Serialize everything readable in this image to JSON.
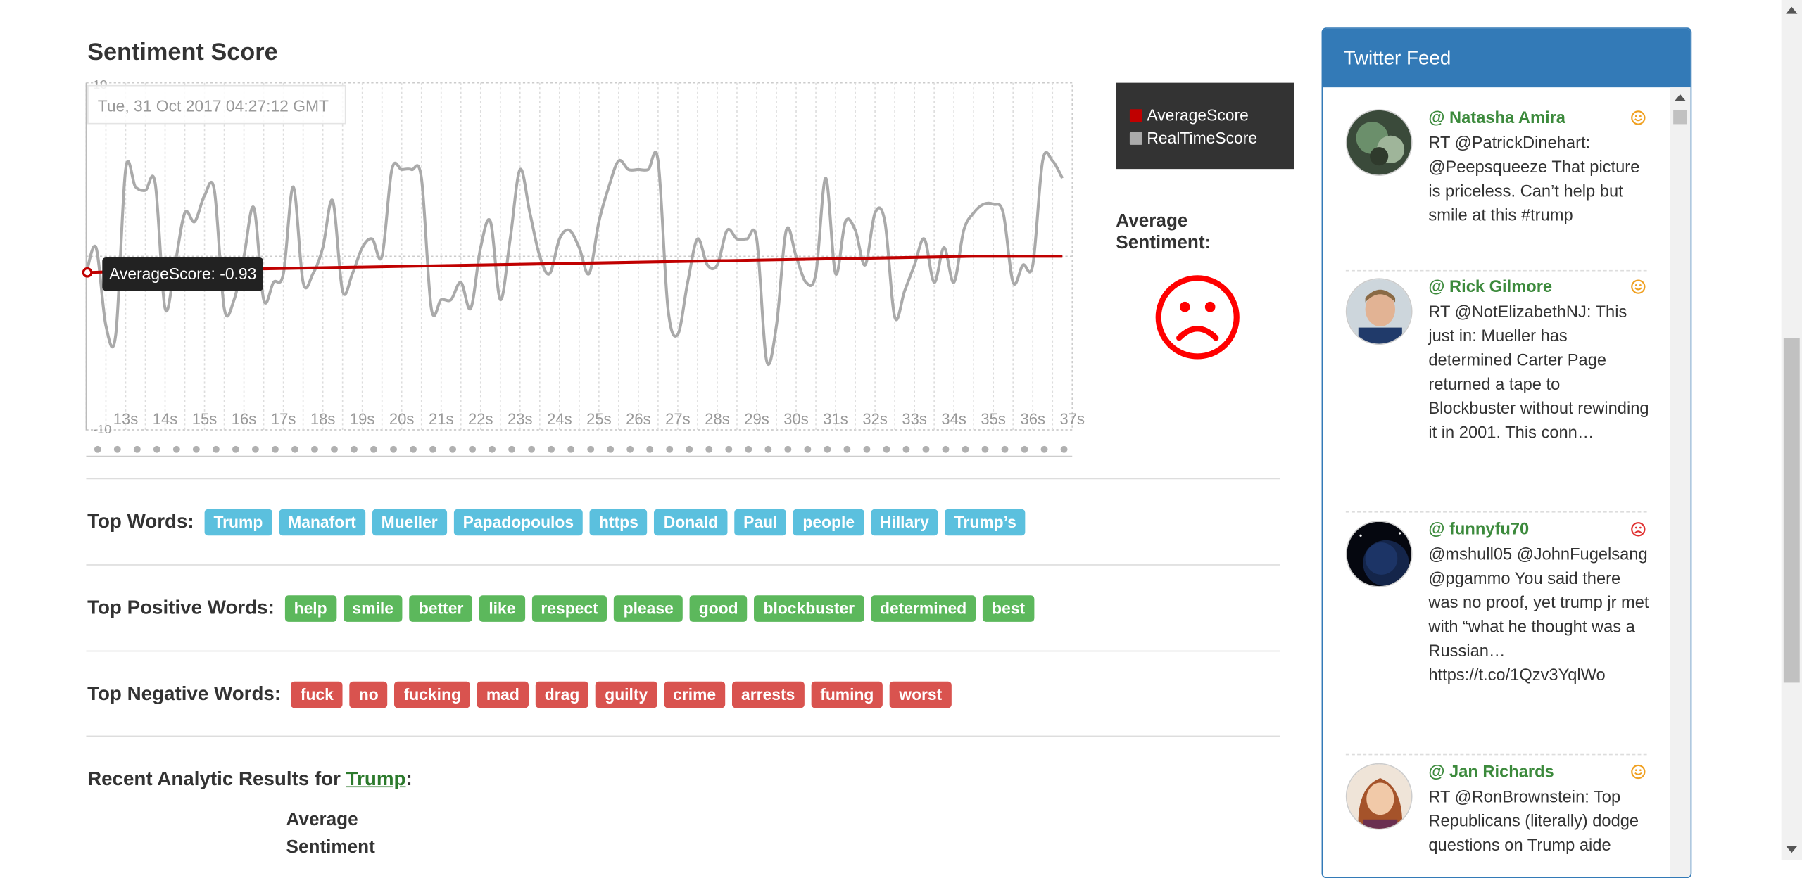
{
  "page": {
    "title": "Sentiment Score",
    "top_words_label": "Top Words:",
    "top_positive_label": "Top Positive Words:",
    "top_negative_label": "Top Negative Words:",
    "recent_prefix": "Recent Analytic Results for ",
    "recent_term": "Trump",
    "recent_suffix": ":",
    "avg_sentiment_line1": "Average",
    "avg_sentiment_line2": "Sentiment"
  },
  "top_words": [
    "Trump",
    "Manafort",
    "Mueller",
    "Papadopoulos",
    "https",
    "Donald",
    "Paul",
    "people",
    "Hillary",
    "Trump’s"
  ],
  "top_positive_words": [
    "help",
    "smile",
    "better",
    "like",
    "respect",
    "please",
    "good",
    "blockbuster",
    "determined",
    "best"
  ],
  "top_negative_words": [
    "fuck",
    "no",
    "fucking",
    "mad",
    "drag",
    "guilty",
    "crime",
    "arrests",
    "fuming",
    "worst"
  ],
  "sentiment_panel": {
    "label": "Average Sentiment:",
    "face": "sad-face-icon",
    "face_color": "#ff0000"
  },
  "chart_data": {
    "type": "line",
    "hover_date": "Tue, 31 Oct 2017 04:27:12 GMT",
    "hover_tooltip": "AverageScore: -0.93",
    "ylim": [
      -10,
      10
    ],
    "y_ticks": [
      "10",
      "-10"
    ],
    "x_tick_labels": [
      "13s",
      "14s",
      "15s",
      "16s",
      "17s",
      "18s",
      "19s",
      "20s",
      "21s",
      "22s",
      "23s",
      "24s",
      "25s",
      "26s",
      "27s",
      "28s",
      "29s",
      "30s",
      "31s",
      "32s",
      "33s",
      "34s",
      "35s",
      "36s",
      "37s"
    ],
    "grid": true,
    "legend_position": "right",
    "x": [
      12.0,
      12.25,
      12.5,
      12.75,
      13.0,
      13.25,
      13.5,
      13.75,
      14.0,
      14.25,
      14.5,
      14.75,
      15.0,
      15.25,
      15.5,
      15.75,
      16.0,
      16.25,
      16.5,
      16.75,
      17.0,
      17.25,
      17.5,
      17.75,
      18.0,
      18.25,
      18.5,
      18.75,
      19.0,
      19.25,
      19.5,
      19.75,
      20.0,
      20.25,
      20.5,
      20.75,
      21.0,
      21.25,
      21.5,
      21.75,
      22.0,
      22.25,
      22.5,
      22.75,
      23.0,
      23.25,
      23.5,
      23.75,
      24.0,
      24.25,
      24.5,
      24.75,
      25.0,
      25.25,
      25.5,
      25.75,
      26.0,
      26.25,
      26.5,
      26.75,
      27.0,
      27.25,
      27.5,
      27.75,
      28.0,
      28.25,
      28.5,
      28.75,
      29.0,
      29.25,
      29.5,
      29.75,
      30.0,
      30.25,
      30.5,
      30.75,
      31.0,
      31.25,
      31.5,
      31.75,
      32.0,
      32.25,
      32.5,
      32.75,
      33.0,
      33.25,
      33.5,
      33.75,
      34.0,
      34.25,
      34.5,
      34.75,
      35.0,
      35.25,
      35.5,
      35.75,
      36.0,
      36.25,
      36.5,
      36.75
    ],
    "series": [
      {
        "name": "AverageScore",
        "color": "#c00000",
        "values": [
          -0.93,
          -0.92,
          -0.9,
          -0.88,
          -0.86,
          -0.85,
          -0.84,
          -0.83,
          -0.82,
          -0.81,
          -0.8,
          -0.79,
          -0.78,
          -0.77,
          -0.76,
          -0.75,
          -0.74,
          -0.73,
          -0.72,
          -0.71,
          -0.7,
          -0.69,
          -0.68,
          -0.67,
          -0.66,
          -0.65,
          -0.64,
          -0.63,
          -0.62,
          -0.61,
          -0.6,
          -0.59,
          -0.58,
          -0.57,
          -0.56,
          -0.55,
          -0.54,
          -0.53,
          -0.52,
          -0.51,
          -0.5,
          -0.49,
          -0.48,
          -0.47,
          -0.46,
          -0.45,
          -0.44,
          -0.43,
          -0.42,
          -0.41,
          -0.4,
          -0.39,
          -0.38,
          -0.37,
          -0.36,
          -0.35,
          -0.34,
          -0.33,
          -0.32,
          -0.31,
          -0.3,
          -0.29,
          -0.28,
          -0.27,
          -0.26,
          -0.25,
          -0.24,
          -0.23,
          -0.22,
          -0.21,
          -0.2,
          -0.19,
          -0.18,
          -0.17,
          -0.16,
          -0.15,
          -0.14,
          -0.13,
          -0.12,
          -0.11,
          -0.1,
          -0.09,
          -0.08,
          -0.07,
          -0.06,
          -0.05,
          -0.04,
          -0.03,
          -0.02,
          -0.01,
          0.0,
          0.0,
          0.0,
          0.0,
          0.0,
          0.0,
          0.0,
          0.0,
          0.0,
          0.0
        ]
      },
      {
        "name": "RealTimeScore",
        "color": "#aaaaaa",
        "values": [
          -1,
          0.5,
          -4,
          -4.5,
          5,
          4,
          3.8,
          4.2,
          -3,
          -0.5,
          2.5,
          2,
          3.5,
          3.8,
          -3,
          -2.5,
          0,
          2.8,
          -2.5,
          -1.5,
          -1,
          4,
          -1.5,
          -1,
          0.5,
          3.2,
          -2,
          -1,
          0.5,
          1,
          0,
          5,
          5,
          5,
          4.5,
          -3,
          -2.5,
          -2.5,
          -1.5,
          -3,
          0.5,
          2,
          -2.5,
          1,
          5,
          2.5,
          0,
          -1,
          1,
          1.5,
          0.5,
          -1,
          2,
          4,
          5.5,
          5,
          5,
          5,
          5.5,
          -3,
          -4.5,
          -1.5,
          1,
          -0.5,
          -0.5,
          1.5,
          1,
          1,
          1,
          -6,
          -4,
          1.5,
          0,
          -1.5,
          -1,
          4.5,
          -1,
          2,
          1.5,
          -0.5,
          2.5,
          2,
          -3.5,
          -2,
          -0.5,
          1,
          -1.5,
          0.5,
          -1.5,
          1.5,
          2.5,
          3,
          3,
          2.5,
          -1.5,
          -0.5,
          -0.5,
          5.5,
          5.5,
          4.5
        ]
      }
    ]
  },
  "twitter": {
    "title": "Twitter Feed",
    "tweets": [
      {
        "user": "@ Natasha Amira",
        "mood": "smile-icon",
        "text": "RT @PatrickDinehart: @Peepsqueeze That picture is priceless. Can’t help but smile at this #trump"
      },
      {
        "user": "@ Rick Gilmore",
        "mood": "smile-icon",
        "text": "RT @NotElizabethNJ: This just in: Mueller has determined Carter Page returned a tape to Blockbuster without rewinding it in 2001. This conn…"
      },
      {
        "user": "@ funnyfu70",
        "mood": "frown-icon",
        "text": "@mshull05 @JohnFugelsang @pgammo You said there was no proof, yet trump jr met with “what he thought was a Russian… https://t.co/1Qzv3YqlWo"
      },
      {
        "user": "@ Jan Richards",
        "mood": "smile-icon",
        "text": "RT @RonBrownstein: Top Republicans (literally) dodge questions on Trump aide"
      }
    ]
  }
}
